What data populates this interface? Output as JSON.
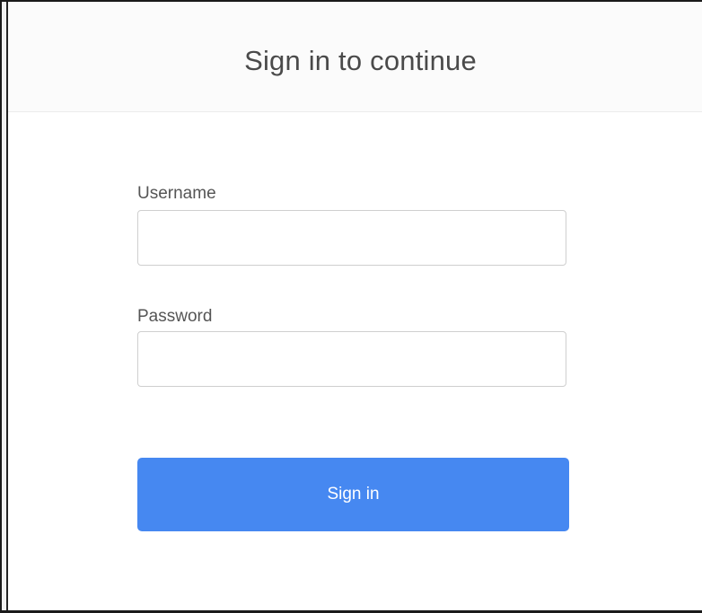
{
  "header": {
    "title": "Sign in to continue"
  },
  "form": {
    "username": {
      "label": "Username",
      "value": "",
      "placeholder": ""
    },
    "password": {
      "label": "Password",
      "value": "",
      "placeholder": ""
    },
    "submit_label": "Sign in"
  },
  "colors": {
    "button_background": "#4688f1",
    "button_text": "#ffffff",
    "title_text": "#4a4a4a",
    "label_text": "#555555",
    "input_border": "#cfcfcf"
  }
}
